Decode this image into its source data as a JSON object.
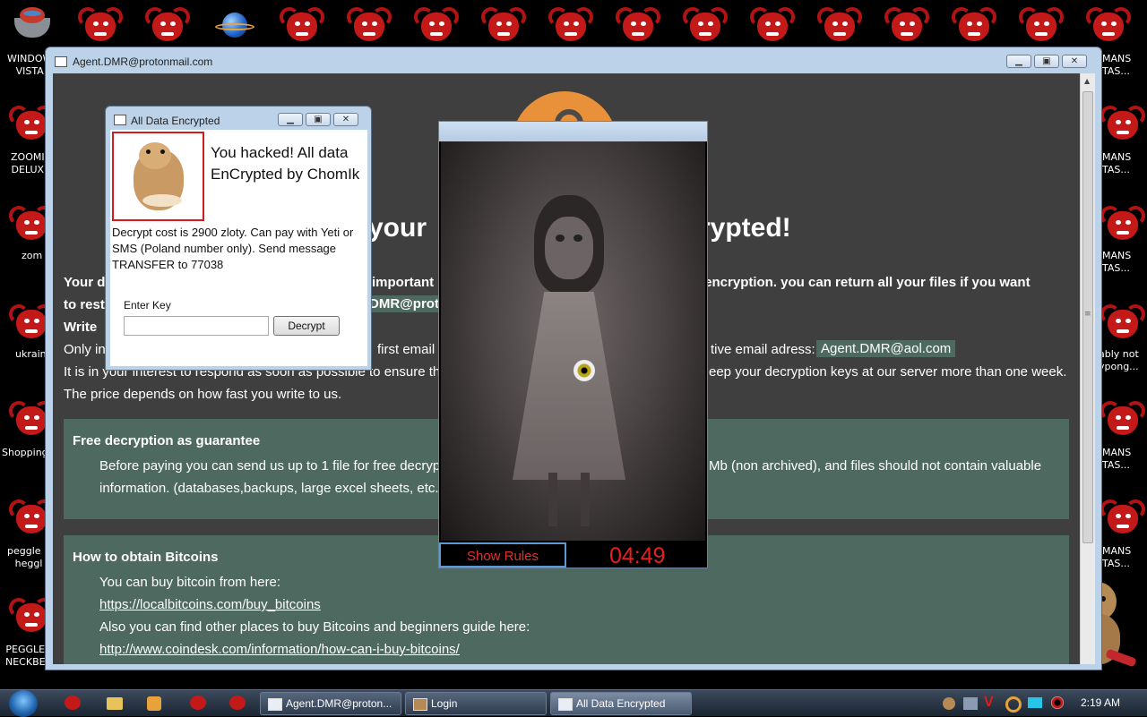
{
  "desktop": {
    "left_icons": [
      {
        "label_1": "WINDOW",
        "label_2": "VISTA"
      },
      {
        "label_1": "ZOOMI",
        "label_2": "DELUX"
      },
      {
        "label_1": "zom",
        "label_2": ""
      },
      {
        "label_1": "ukrain",
        "label_2": ""
      },
      {
        "label_1": "Shopping",
        "label_2": ""
      },
      {
        "label_1": "peggle n",
        "label_2": "heggl"
      },
      {
        "label_1": "PEGGLE",
        "label_2": "NECKBE"
      }
    ],
    "right_icons": [
      {
        "label_1": "MANS",
        "label_2": "TAS..."
      },
      {
        "label_1": "MANS",
        "label_2": "TAS..."
      },
      {
        "label_1": "MANS",
        "label_2": "TAS..."
      },
      {
        "label_1": "ably not",
        "label_2": "ypong..."
      },
      {
        "label_1": "MANS",
        "label_2": "TAS..."
      },
      {
        "label_1": "MANS",
        "label_2": "TAS..."
      }
    ]
  },
  "main_window": {
    "title": "Agent.DMR@protonmail.com",
    "headline_left": "your",
    "headline_right": "rypted!",
    "para1_left": "Your d",
    "para1_mid": "important",
    "para1_right": "t encryption. you can return all your files if you want",
    "para2_left": "to rest",
    "para2_email": "DMR@prot",
    "write_label": "Write",
    "only_left": "Only in",
    "only_mid": "first email",
    "only_right": "tive email adress:",
    "alt_email": "Agent.DMR@aol.com",
    "interest_left": "It is in your interest to respond as soon as possible to ensure th",
    "interest_right": "eep your decryption keys at our server more than one week.",
    "price_line": "The price depends on how fast you write to us.",
    "guarantee": {
      "heading": "Free decryption as guarantee",
      "line1_left": "Before paying you can send us up to 1 file for free decryp",
      "line1_right": "Mb (non archived), and files should not contain valuable",
      "line2": "information. (databases,backups, large excel sheets, etc.)"
    },
    "bitcoin": {
      "heading": "How to obtain Bitcoins",
      "line1": "You can buy bitcoin from here:",
      "link1": "https://localbitcoins.com/buy_bitcoins",
      "line2": "Also you can find other places to buy Bitcoins and beginners guide here:",
      "link2": "http://www.coindesk.com/information/how-can-i-buy-bitcoins/"
    }
  },
  "chomik_window": {
    "title": "All Data Encrypted",
    "headline": "You hacked! All data EnCrypted by ChomIk",
    "message": "Decrypt cost is 2900 zloty. Can pay with Yeti or SMS (Poland number only). Send message TRANSFER to 77038",
    "key_label": "Enter Key",
    "key_value": "",
    "decrypt_button": "Decrypt"
  },
  "video_window": {
    "show_rules_button": "Show Rules",
    "timer": "04:49"
  },
  "taskbar": {
    "tasks": [
      "Agent.DMR@proton...",
      "Login",
      "All Data Encrypted"
    ],
    "tray_letter": "V",
    "clock": "2:19 AM"
  },
  "colors": {
    "page_bg": "#3f3f3f",
    "panel_green": "#4e6a60",
    "timer_red": "#e32020",
    "demon_red": "#c41919",
    "orange_logo": "#e8913a"
  },
  "icons": {
    "start": "windows-start-orb-icon",
    "window": "window-app-icon",
    "hamster": "hamster-image",
    "demon": "red-demon-desktop-icon"
  }
}
